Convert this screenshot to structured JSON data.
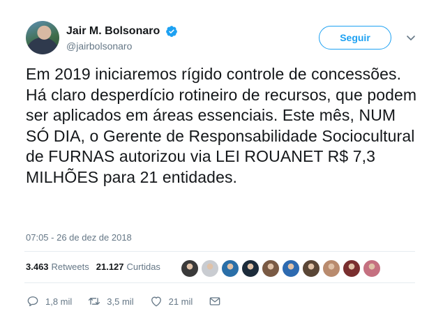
{
  "author": {
    "display_name": "Jair M. Bolsonaro",
    "handle": "@jairbolsonaro",
    "verified": true
  },
  "follow_button_label": "Seguir",
  "tweet": {
    "text": "Em 2019 iniciaremos rígido controle de concessões. Há claro desperdício rotineiro de recursos, que podem ser aplicados em áreas essenciais. Este mês, NUM SÓ DIA, o Gerente de Responsabilidade Sociocultural de FURNAS autorizou via LEI ROUANET R$ 7,3 MILHÕES para 21 entidades.",
    "timestamp": "07:05 - 26 de dez de 2018"
  },
  "stats": {
    "retweets_count": "3.463",
    "retweets_label": "Retweets",
    "likes_count": "21.127",
    "likes_label": "Curtidas"
  },
  "liker_avatars": [
    "#3a3a3a",
    "#c9ccd1",
    "#2a6fa8",
    "#1c2b3a",
    "#7a5a44",
    "#2d6ab0",
    "#5a4636",
    "#b98b6e",
    "#7a2f2f",
    "#c57080"
  ],
  "actions": {
    "reply_count": "1,8 mil",
    "retweet_count": "3,5 mil",
    "like_count": "21 mil"
  },
  "colors": {
    "accent": "#1da1f2",
    "secondary_text": "#657786",
    "divider": "#e6ecf0"
  }
}
